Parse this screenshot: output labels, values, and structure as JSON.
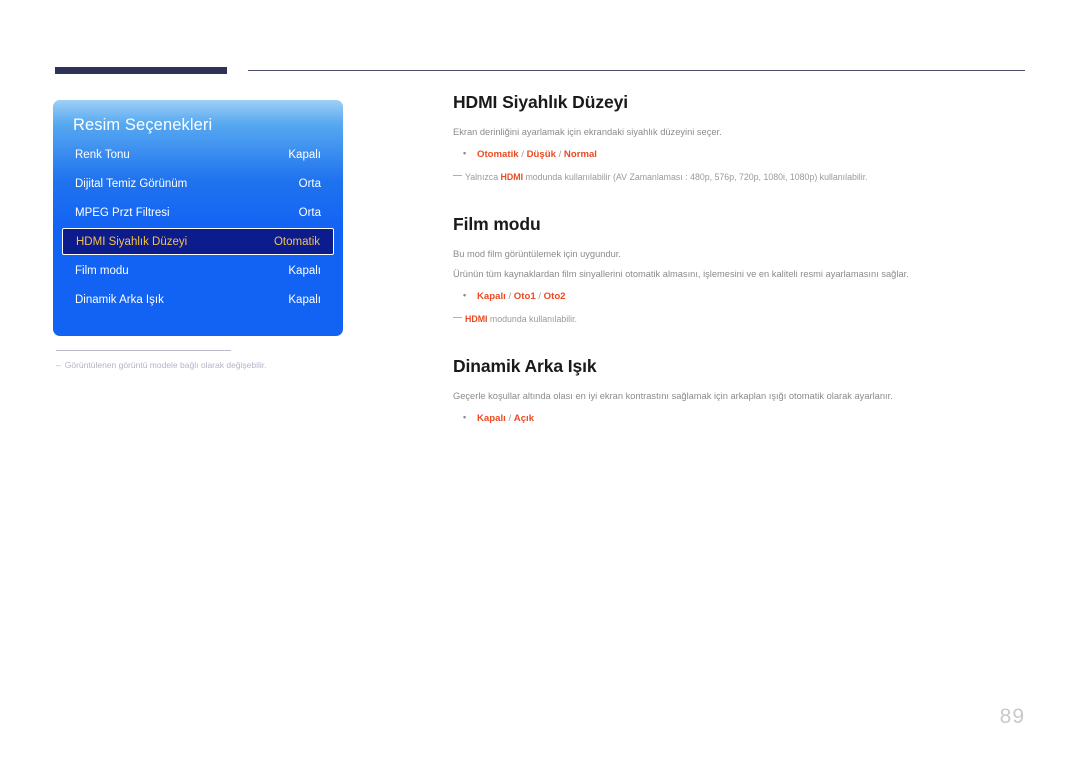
{
  "page": {
    "number": "89"
  },
  "osd": {
    "title": "Resim Seçenekleri",
    "rows": [
      {
        "label": "Renk Tonu",
        "value": "Kapalı",
        "selected": false
      },
      {
        "label": "Dijital Temiz Görünüm",
        "value": "Orta",
        "selected": false
      },
      {
        "label": "MPEG Przt Filtresi",
        "value": "Orta",
        "selected": false
      },
      {
        "label": "HDMI Siyahlık Düzeyi",
        "value": "Otomatik",
        "selected": true
      },
      {
        "label": "Film modu",
        "value": "Kapalı",
        "selected": false
      },
      {
        "label": "Dinamik Arka Işık",
        "value": "Kapalı",
        "selected": false
      }
    ],
    "footnote_dash": "–",
    "footnote": "Görüntülenen görüntü modele bağlı olarak değişebilir."
  },
  "sections": [
    {
      "heading": "HDMI Siyahlık Düzeyi",
      "body": [
        "Ekran derinliğini ayarlamak için ekrandaki siyahlık düzeyini seçer."
      ],
      "options": {
        "o1": "Otomatik",
        "s1": " / ",
        "o2": "Düşük",
        "s2": " / ",
        "o3": "Normal"
      },
      "note": {
        "pre": "Yalnızca ",
        "em": "HDMI",
        "post": " modunda kullanılabilir (AV Zamanlaması : 480p, 576p, 720p, 1080i, 1080p) kullanılabilir."
      }
    },
    {
      "heading": "Film modu",
      "body": [
        "Bu mod film görüntülemek için uygundur.",
        "Ürünün tüm kaynaklardan film sinyallerini otomatik almasını, işlemesini ve en kaliteli resmi ayarlamasını sağlar."
      ],
      "options": {
        "o1": "Kapalı",
        "s1": " / ",
        "o2": "Oto1",
        "s2": " / ",
        "o3": "Oto2"
      },
      "note": {
        "pre": "",
        "em": "HDMI",
        "post": " modunda kullanılabilir."
      }
    },
    {
      "heading": "Dinamik Arka Işık",
      "body": [
        "Geçerle koşullar altında olası en iyi ekran kontrastını sağlamak için arkaplan ışığı otomatik olarak ayarlanır."
      ],
      "options": {
        "o1": "Kapalı",
        "s1": " / ",
        "o2": "Açık",
        "s2": "",
        "o3": ""
      }
    }
  ],
  "colors": {
    "accent_red": "#ea4b22",
    "osd_blue": "#1262f4",
    "osd_selected_bg": "#0d1c8c",
    "osd_selected_text": "#f5c243",
    "header_bar": "#2e3257"
  }
}
